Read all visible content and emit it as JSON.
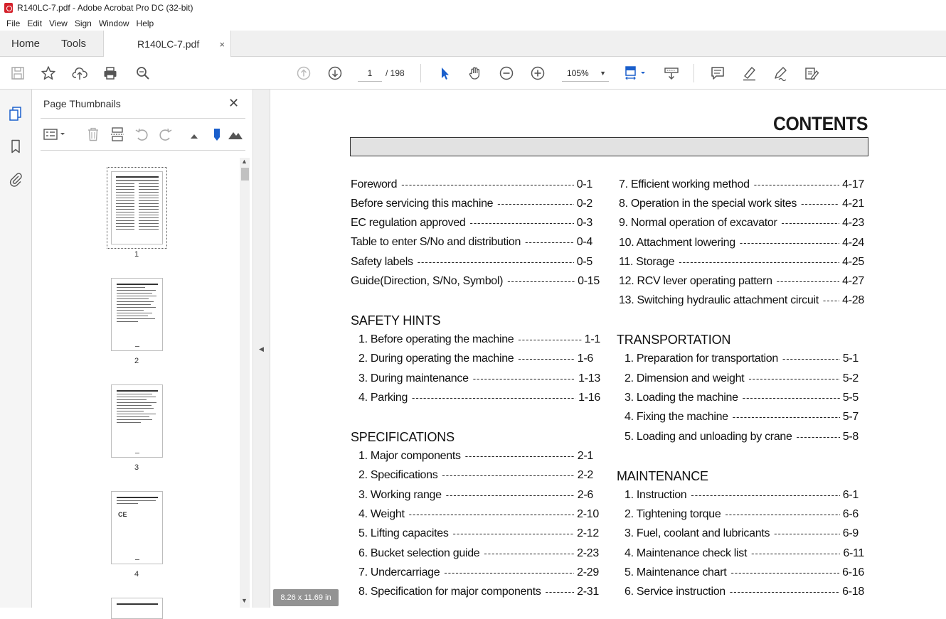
{
  "window": {
    "title": "R140LC-7.pdf - Adobe Acrobat Pro DC (32-bit)"
  },
  "menu": [
    "File",
    "Edit",
    "View",
    "Sign",
    "Window",
    "Help"
  ],
  "tabs": {
    "home": "Home",
    "tools": "Tools",
    "document": "R140LC-7.pdf",
    "close": "×"
  },
  "toolbar": {
    "page_current": "1",
    "page_total": "/ 198",
    "zoom": "105%"
  },
  "thumbnails": {
    "title": "Page Thumbnails",
    "close": "✕",
    "pages": [
      "1",
      "2",
      "3",
      "4"
    ]
  },
  "page_size_badge": "8.26 x 11.69 in",
  "document": {
    "title": "CONTENTS",
    "left_column": [
      {
        "label": "Foreword",
        "page": "0-1"
      },
      {
        "label": "Before servicing this machine",
        "page": "0-2"
      },
      {
        "label": "EC regulation approved",
        "page": "0-3"
      },
      {
        "label": "Table to enter S/No and distribution",
        "page": "0-4"
      },
      {
        "label": "Safety labels",
        "page": "0-5"
      },
      {
        "label": "Guide(Direction, S/No, Symbol)",
        "page": "0-15"
      }
    ],
    "safety_hints": {
      "heading": "SAFETY HINTS",
      "items": [
        {
          "label": "1. Before operating the machine",
          "page": "1-1"
        },
        {
          "label": "2. During operating the machine",
          "page": "1-6"
        },
        {
          "label": "3. During maintenance",
          "page": "1-13"
        },
        {
          "label": "4. Parking",
          "page": "1-16"
        }
      ]
    },
    "specifications": {
      "heading": "SPECIFICATIONS",
      "items": [
        {
          "label": "1. Major components",
          "page": "2-1"
        },
        {
          "label": "2. Specifications",
          "page": "2-2"
        },
        {
          "label": "3. Working range",
          "page": "2-6"
        },
        {
          "label": "4. Weight",
          "page": "2-10"
        },
        {
          "label": "5. Lifting capacites",
          "page": "2-12"
        },
        {
          "label": "6. Bucket selection guide",
          "page": "2-23"
        },
        {
          "label": "7. Undercarriage",
          "page": "2-29"
        },
        {
          "label": "8. Specification for major components",
          "page": "2-31"
        }
      ]
    },
    "right_column": [
      {
        "label": "7. Efficient working method",
        "page": "4-17"
      },
      {
        "label": "8. Operation in the special work sites",
        "page": "4-21"
      },
      {
        "label": "9. Normal operation of excavator",
        "page": "4-23"
      },
      {
        "label": "10. Attachment lowering",
        "page": "4-24"
      },
      {
        "label": "11. Storage",
        "page": "4-25"
      },
      {
        "label": "12. RCV lever operating pattern",
        "page": "4-27"
      },
      {
        "label": "13. Switching hydraulic attachment circuit",
        "page": "4-28"
      }
    ],
    "transportation": {
      "heading": "TRANSPORTATION",
      "items": [
        {
          "label": "1. Preparation for transportation",
          "page": "5-1"
        },
        {
          "label": "2. Dimension and weight",
          "page": "5-2"
        },
        {
          "label": "3. Loading the machine",
          "page": "5-5"
        },
        {
          "label": "4. Fixing the machine",
          "page": "5-7"
        },
        {
          "label": "5. Loading and unloading by crane",
          "page": "5-8"
        }
      ]
    },
    "maintenance": {
      "heading": "MAINTENANCE",
      "items": [
        {
          "label": "1. Instruction",
          "page": "6-1"
        },
        {
          "label": "2. Tightening torque",
          "page": "6-6"
        },
        {
          "label": "3. Fuel, coolant and lubricants",
          "page": "6-9"
        },
        {
          "label": "4. Maintenance check list",
          "page": "6-11"
        },
        {
          "label": "5. Maintenance chart",
          "page": "6-16"
        },
        {
          "label": "6. Service instruction",
          "page": "6-18"
        }
      ]
    }
  }
}
